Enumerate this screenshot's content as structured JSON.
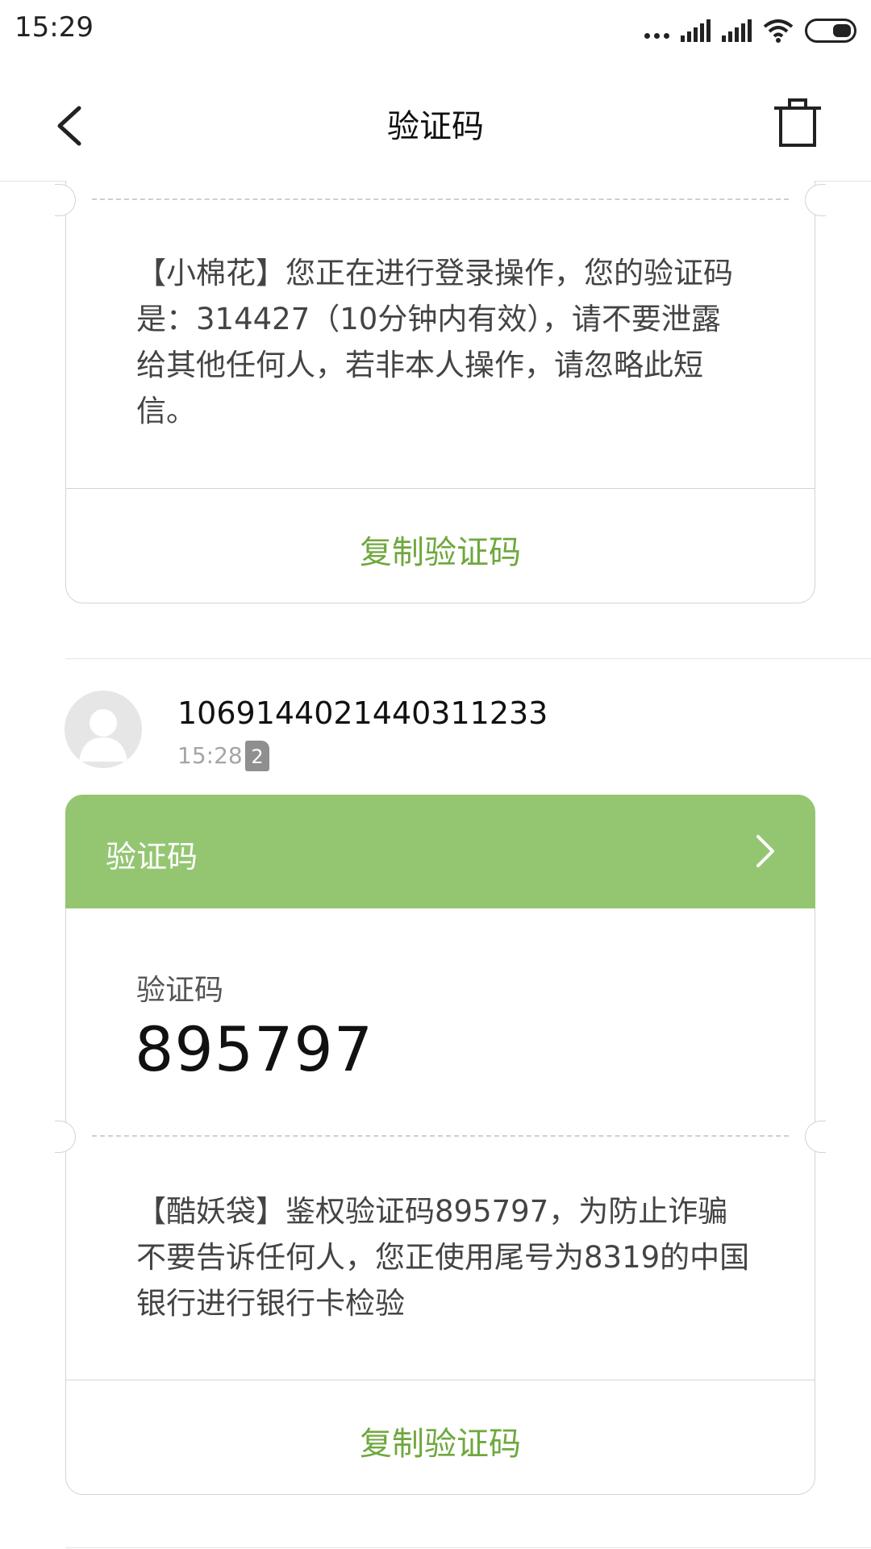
{
  "status_bar": {
    "time": "15:29"
  },
  "header": {
    "title": "验证码"
  },
  "messages": [
    {
      "text": "【小棉花】您正在进行登录操作，您的验证码是：314427（10分钟内有效），请不要泄露给其他任何人，若非本人操作，请忽略此短信。",
      "copy_label": "复制验证码"
    },
    {
      "sender": "1069144021440311233",
      "time": "15:28",
      "sim": "2",
      "card_title": "验证码",
      "code_label": "验证码",
      "code": "895797",
      "text": "【酷妖袋】鉴权验证码895797，为防止诈骗不要告诉任何人，您正使用尾号为8319的中国银行进行银行卡检验",
      "copy_label": "复制验证码"
    }
  ],
  "colors": {
    "accent": "#6fa83e",
    "card_header": "#94c672"
  },
  "icons": [
    "back-arrow-icon",
    "trash-icon",
    "chevron-right-icon",
    "avatar-icon"
  ]
}
